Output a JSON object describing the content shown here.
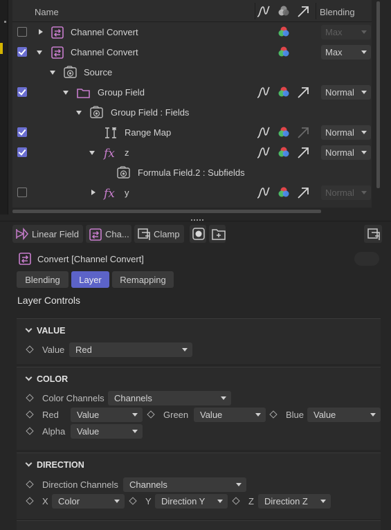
{
  "list": {
    "header": {
      "name": "Name",
      "blending": "Blending"
    },
    "rows": [
      {
        "label": "Channel Convert",
        "blend": "Max",
        "checked": false
      },
      {
        "label": "Channel Convert",
        "blend": "Max",
        "checked": true
      },
      {
        "label": "Source"
      },
      {
        "label": "Group Field",
        "blend": "Normal",
        "checked": true
      },
      {
        "label": "Group Field : Fields"
      },
      {
        "label": "Range Map",
        "blend": "Normal",
        "checked": true
      },
      {
        "label": "z",
        "blend": "Normal",
        "checked": true
      },
      {
        "label": "Formula Field.2 : Subfields"
      },
      {
        "label": "y",
        "blend": "Normal",
        "checked": false
      }
    ]
  },
  "toolbar": {
    "linear_field": "Linear Field",
    "channel_short": "Cha...",
    "clamp": "Clamp"
  },
  "attributes": {
    "title": "Convert [Channel Convert]",
    "tabs": [
      "Blending",
      "Layer",
      "Remapping"
    ],
    "active_tab": "Layer",
    "section_title": "Layer Controls",
    "value_group": {
      "header": "VALUE",
      "value_label": "Value",
      "value": "Red"
    },
    "color_group": {
      "header": "COLOR",
      "channels_label": "Color Channels",
      "channels_value": "Channels",
      "red_label": "Red",
      "red_value": "Value",
      "green_label": "Green",
      "green_value": "Value",
      "blue_label": "Blue",
      "blue_value": "Value",
      "alpha_label": "Alpha",
      "alpha_value": "Value"
    },
    "direction_group": {
      "header": "DIRECTION",
      "channels_label": "Direction Channels",
      "channels_value": "Channels",
      "x_label": "X",
      "x_value": "Color",
      "y_label": "Y",
      "y_value": "Direction Y",
      "z_label": "Z",
      "z_value": "Direction Z"
    }
  },
  "colors": {
    "accent": "#5c63c8",
    "checkbox_on": "#6a6ed0",
    "field_icon": "#c77dcc",
    "rgb_red": "#e0464a",
    "rgb_green": "#4fc46a",
    "rgb_blue": "#4c8df0"
  },
  "icons": [
    "channel-convert-icon",
    "source-icon",
    "folder-icon",
    "range-map-icon",
    "formula-icon",
    "curve-icon",
    "rgb-icon",
    "direction-arrow-icon",
    "linear-field-icon",
    "clamp-icon",
    "record-icon",
    "new-layer-icon"
  ]
}
